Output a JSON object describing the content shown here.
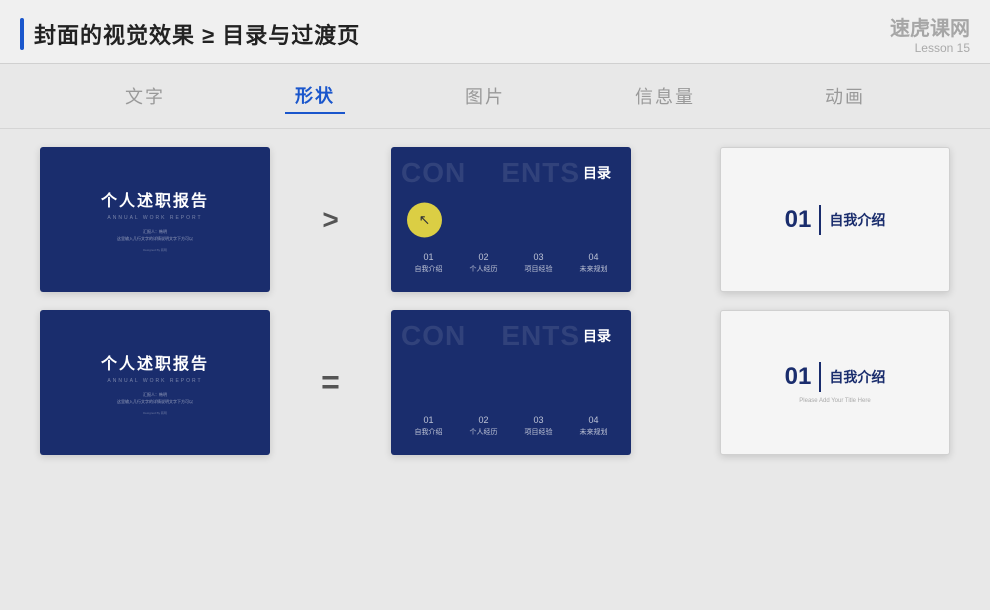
{
  "header": {
    "accent_color": "#1a56cc",
    "title": "封面的视觉效果 ≥ 目录与过渡页",
    "logo_text": "速虎课网",
    "lesson_label": "Lesson 15"
  },
  "nav": {
    "tabs": [
      {
        "id": "text",
        "label": "文字",
        "active": false
      },
      {
        "id": "shape",
        "label": "形状",
        "active": true
      },
      {
        "id": "image",
        "label": "图片",
        "active": false
      },
      {
        "id": "info",
        "label": "信息量",
        "active": false
      },
      {
        "id": "animation",
        "label": "动画",
        "active": false
      }
    ]
  },
  "rows": [
    {
      "id": "row1",
      "operator": ">",
      "cover": {
        "title_cn": "个人述职报告",
        "title_en": "ANNUAL WORK REPORT",
        "author_label": "汇报人：韩明",
        "author_sub": "这里输入几行文字的详情说明文字下方可以",
        "designed": "Designed By 韩明"
      },
      "toc": {
        "bg_text": "CON ENTS",
        "title": "目录",
        "items": [
          {
            "num": "01",
            "label": "自我介绍"
          },
          {
            "num": "02",
            "label": "个人经历"
          },
          {
            "num": "03",
            "label": "项目经验"
          },
          {
            "num": "04",
            "label": "未来规划"
          }
        ],
        "has_cursor": true
      },
      "section": {
        "num": "01",
        "title": "自我介绍",
        "subtitle": null,
        "style": "border"
      }
    },
    {
      "id": "row2",
      "operator": "=",
      "cover": {
        "title_cn": "个人述职报告",
        "title_en": "ANNUAL WORK REPORT",
        "author_label": "汇报人：韩明",
        "author_sub": "这里输入几行文字的详情说明文字下方可以",
        "designed": "Designed By 韩明"
      },
      "toc": {
        "bg_text": "CON ENTS",
        "title": "目录",
        "items": [
          {
            "num": "01",
            "label": "自我介绍"
          },
          {
            "num": "02",
            "label": "个人经历"
          },
          {
            "num": "03",
            "label": "项目经验"
          },
          {
            "num": "04",
            "label": "未来规划"
          }
        ],
        "has_cursor": false
      },
      "section": {
        "num": "01",
        "title": "自我介绍",
        "subtitle": "Please Add Your Title Here",
        "style": "border"
      }
    }
  ],
  "section_num_label": "01",
  "section_title_label": "自我介绍"
}
